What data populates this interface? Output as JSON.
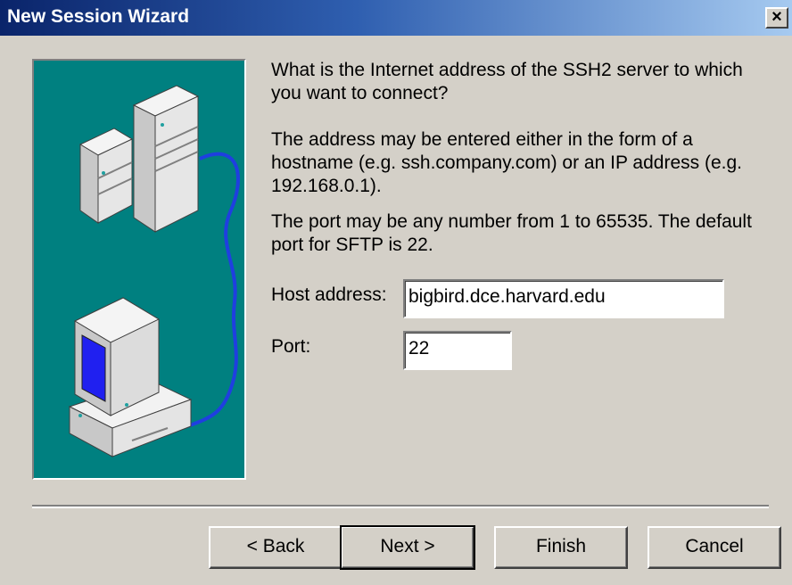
{
  "window": {
    "title": "New Session Wizard",
    "close_icon": "close-icon",
    "close_glyph": "×"
  },
  "illustration": {
    "icon": "servers-network-computer-illustration",
    "background_color": "#008080"
  },
  "instructions": {
    "question": "What is the Internet address of the SSH2 server to which you want to connect?",
    "address_help": "The address may be entered either in the form of a hostname (e.g. ssh.company.com) or an IP address (e.g. 192.168.0.1).",
    "port_help": "The port may be any number from 1 to 65535.  The default port for SFTP is 22."
  },
  "form": {
    "host_label": "Host address:",
    "host_value": "bigbird.dce.harvard.edu",
    "port_label": "Port:",
    "port_value": "22"
  },
  "buttons": {
    "back": "< Back",
    "next": "Next >",
    "finish": "Finish",
    "cancel": "Cancel"
  }
}
